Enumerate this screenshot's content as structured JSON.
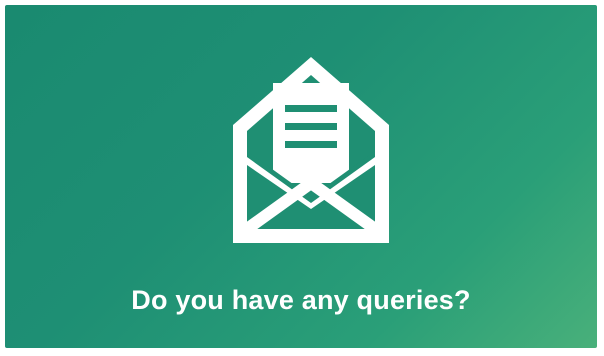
{
  "card": {
    "icon": "open-envelope-icon",
    "caption": "Do you have any queries?",
    "colors": {
      "background_start": "#1a8a70",
      "background_end": "#49b07a",
      "foreground": "#ffffff"
    }
  }
}
